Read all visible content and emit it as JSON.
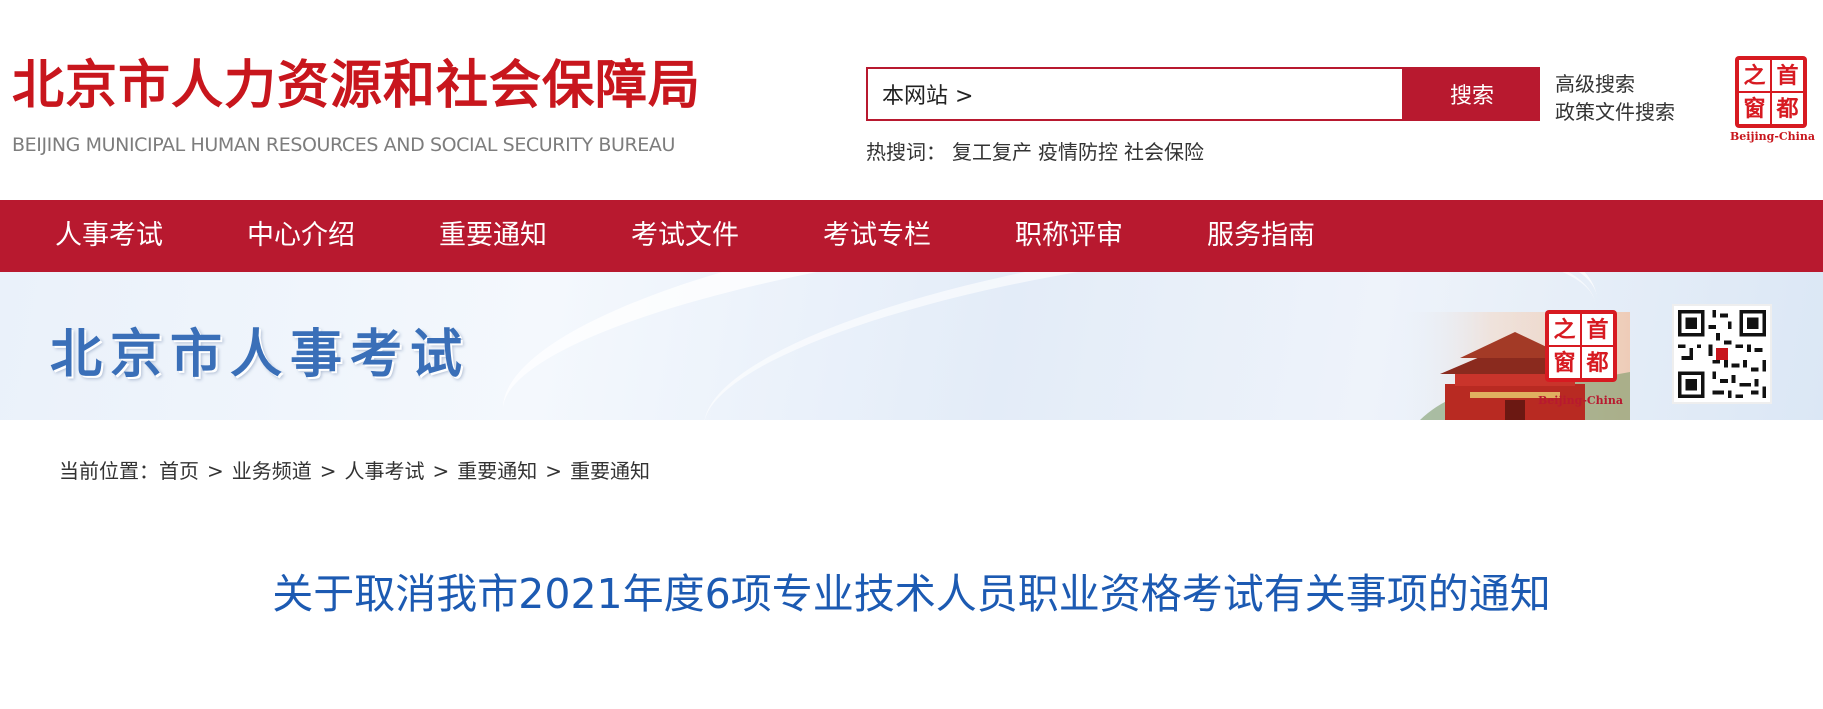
{
  "header": {
    "logo_cn": "北京市人力资源和社会保障局",
    "logo_en": "BEIJING MUNICIPAL HUMAN RESOURCES AND SOCIAL SECURITY BUREAU",
    "search": {
      "value": "本网站 >",
      "button_label": "搜索"
    },
    "advanced_search": "高级搜索",
    "policy_search": "政策文件搜索",
    "hot_label": "热搜词：",
    "hot_words": [
      "复工复产",
      "疫情防控",
      "社会保险"
    ],
    "seal": {
      "chars": [
        "之",
        "首",
        "窗",
        "都"
      ],
      "caption": "Beijing-China"
    }
  },
  "nav": {
    "items": [
      "人事考试",
      "中心介绍",
      "重要通知",
      "考试文件",
      "考试专栏",
      "职称评审",
      "服务指南"
    ]
  },
  "banner": {
    "title": "北京市人事考试",
    "seal": {
      "chars": [
        "之",
        "首",
        "窗",
        "都"
      ],
      "caption": "Beijing-China"
    }
  },
  "breadcrumb": {
    "label": "当前位置：",
    "items": [
      "首页",
      "业务频道",
      "人事考试",
      "重要通知",
      "重要通知"
    ],
    "separator": ">"
  },
  "article": {
    "title": "关于取消我市2021年度6项专业技术人员职业资格考试有关事项的通知"
  },
  "colors": {
    "brand_red": "#b8192f",
    "title_blue": "#1c5ab2",
    "banner_blue": "#3a6fb8"
  }
}
